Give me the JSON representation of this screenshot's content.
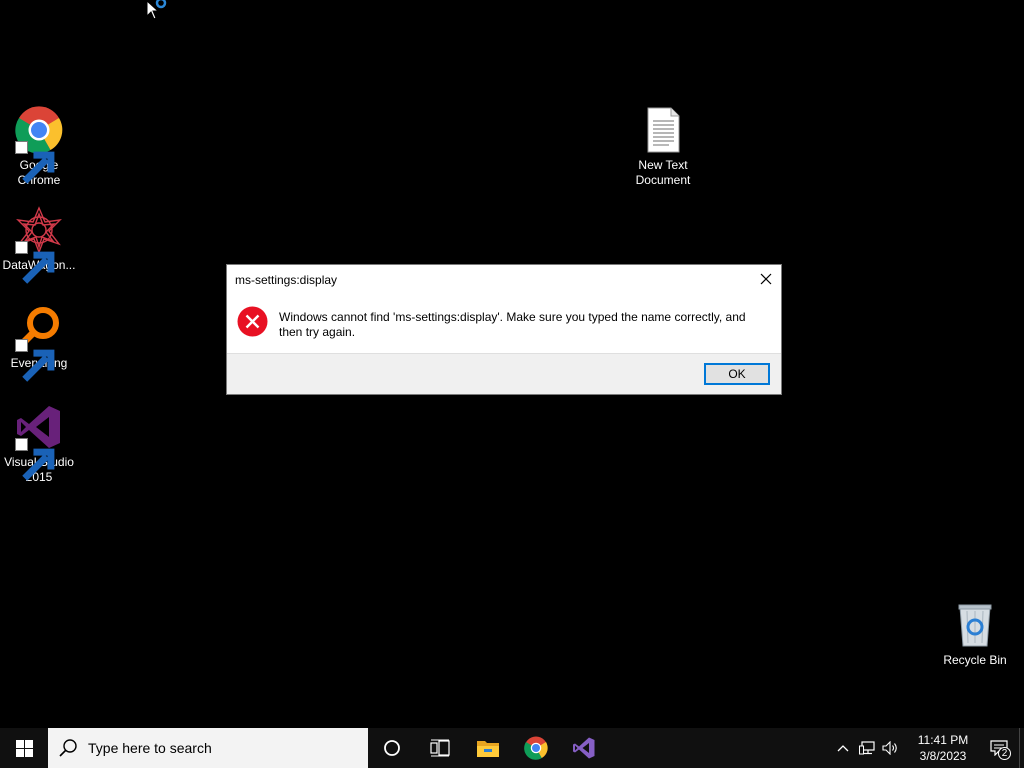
{
  "desktop": {
    "icons": [
      {
        "label": "Google\nChrome",
        "line1": "Google",
        "line2": "Chrome"
      },
      {
        "line1": "DataWagon..."
      },
      {
        "line1": "Everything"
      },
      {
        "line1": "Visual Studio",
        "line2": "2015"
      },
      {
        "line1": "New Text",
        "line2": "Document"
      },
      {
        "line1": "Recycle Bin"
      }
    ]
  },
  "dialog": {
    "title": "ms-settings:display",
    "message": "Windows cannot find 'ms-settings:display'. Make sure you typed the name correctly, and then try again.",
    "ok_label": "OK"
  },
  "taskbar": {
    "search_placeholder": "Type here to search",
    "pinned": [
      "cortana-icon",
      "task-view-icon",
      "file-explorer-icon",
      "chrome-icon",
      "visual-studio-icon"
    ],
    "clock_time": "11:41 PM",
    "clock_date": "3/8/2023",
    "notification_count": "2"
  },
  "colors": {
    "desktop_bg": "#000000",
    "taskbar_bg": "#101010",
    "accent": "#0078d7",
    "error_red": "#e81123"
  }
}
